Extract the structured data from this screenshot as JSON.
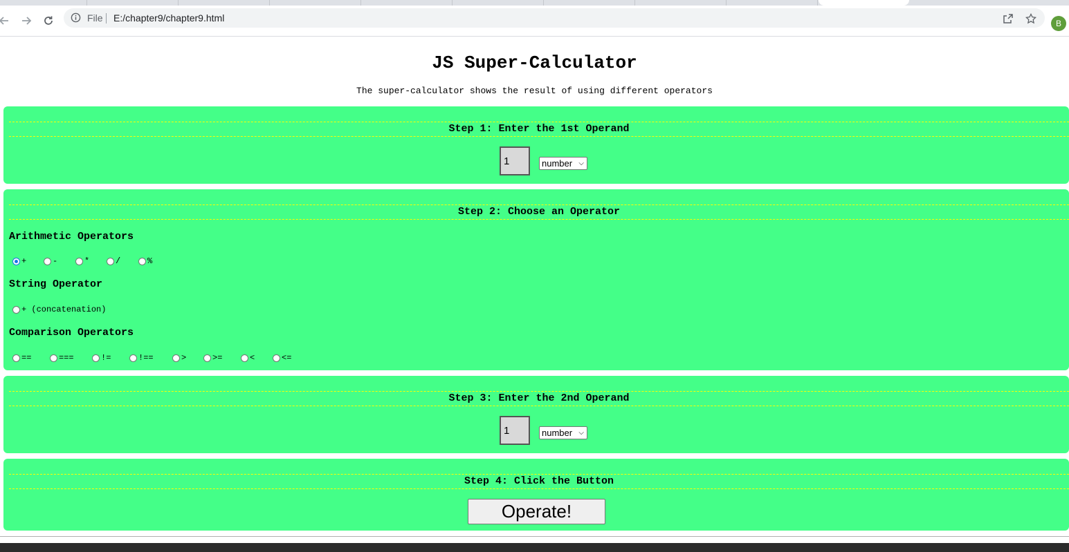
{
  "browser": {
    "file_label": "File",
    "url": "E:/chapter9/chapter9.html",
    "profile_initial": "B"
  },
  "page": {
    "title": "JS Super-Calculator",
    "subtitle": "The super-calculator shows the result of using different operators"
  },
  "step1": {
    "heading": "Step 1: Enter the 1st Operand",
    "operand_value": "1",
    "type_selected": "number"
  },
  "step2": {
    "heading": "Step 2: Choose an Operator",
    "arithmetic_label": "Arithmetic Operators",
    "arithmetic_ops": [
      "+",
      "-",
      "*",
      "/",
      "%"
    ],
    "string_label": "String Operator",
    "string_op": "+",
    "string_note": "(concatenation)",
    "comparison_label": "Comparison Operators",
    "comparison_ops": [
      "==",
      "===",
      "!=",
      "!==",
      ">",
      ">=",
      "<",
      "<="
    ],
    "selected": "+"
  },
  "step3": {
    "heading": "Step 3: Enter the 2nd Operand",
    "operand_value": "1",
    "type_selected": "number"
  },
  "step4": {
    "heading": "Step 4: Click the Button",
    "button_label": "Operate!"
  },
  "colors": {
    "panel": "#44ff88",
    "dash": "#ffff00",
    "radio_selected": "#1a73e8"
  }
}
